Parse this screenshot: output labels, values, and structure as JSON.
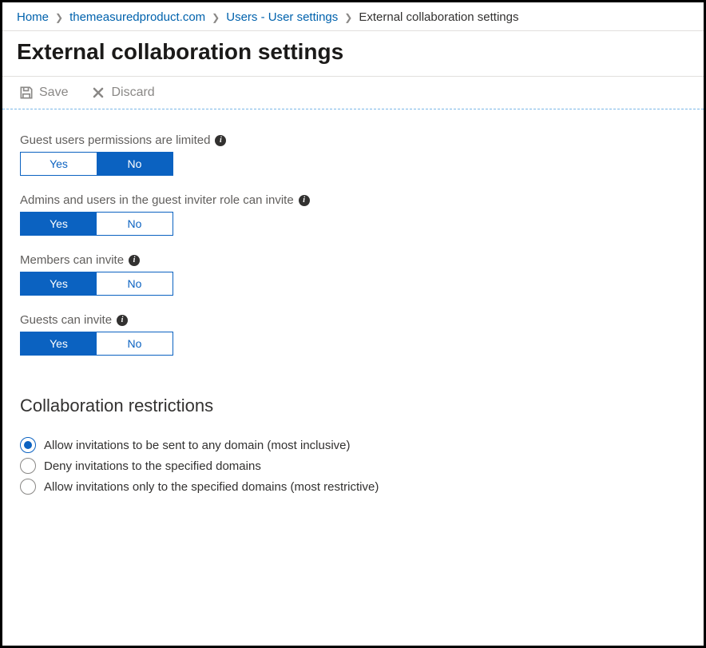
{
  "breadcrumb": {
    "items": [
      {
        "label": "Home",
        "link": true
      },
      {
        "label": "themeasuredproduct.com",
        "link": true
      },
      {
        "label": "Users - User settings",
        "link": true
      },
      {
        "label": "External collaboration settings",
        "link": false
      }
    ]
  },
  "page": {
    "title": "External collaboration settings"
  },
  "toolbar": {
    "save_label": "Save",
    "discard_label": "Discard"
  },
  "toggle_labels": {
    "yes": "Yes",
    "no": "No"
  },
  "settings": [
    {
      "label": "Guest users permissions are limited",
      "value": "No"
    },
    {
      "label": "Admins and users in the guest inviter role can invite",
      "value": "Yes"
    },
    {
      "label": "Members can invite",
      "value": "Yes"
    },
    {
      "label": "Guests can invite",
      "value": "Yes"
    }
  ],
  "restrictions": {
    "heading": "Collaboration restrictions",
    "options": [
      {
        "label": "Allow invitations to be sent to any domain (most inclusive)",
        "selected": true
      },
      {
        "label": "Deny invitations to the specified domains",
        "selected": false
      },
      {
        "label": "Allow invitations only to the specified domains (most restrictive)",
        "selected": false
      }
    ]
  }
}
